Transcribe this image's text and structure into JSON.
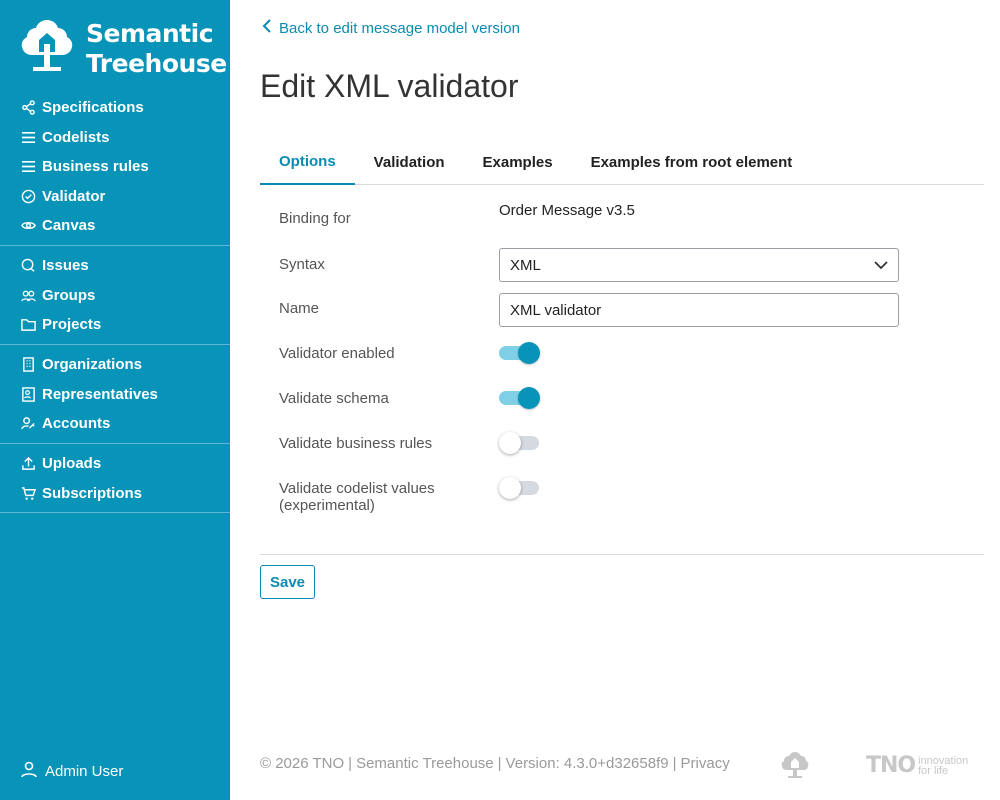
{
  "brand": {
    "name_line1": "Semantic",
    "name_line2": "Treehouse"
  },
  "sidebar": {
    "groups": [
      {
        "items": [
          {
            "label": "Specifications",
            "icon": "share-icon"
          },
          {
            "label": "Codelists",
            "icon": "list-icon"
          },
          {
            "label": "Business rules",
            "icon": "list-icon"
          },
          {
            "label": "Validator",
            "icon": "check-circle-icon"
          },
          {
            "label": "Canvas",
            "icon": "eye-icon"
          }
        ]
      },
      {
        "items": [
          {
            "label": "Issues",
            "icon": "chat-icon"
          },
          {
            "label": "Groups",
            "icon": "users-icon"
          },
          {
            "label": "Projects",
            "icon": "folder-icon"
          }
        ]
      },
      {
        "items": [
          {
            "label": "Organizations",
            "icon": "building-icon"
          },
          {
            "label": "Representatives",
            "icon": "id-card-icon"
          },
          {
            "label": "Accounts",
            "icon": "user-key-icon"
          }
        ]
      },
      {
        "items": [
          {
            "label": "Uploads",
            "icon": "upload-icon"
          },
          {
            "label": "Subscriptions",
            "icon": "cart-icon"
          }
        ]
      }
    ],
    "user": "Admin User"
  },
  "main": {
    "back_link": "Back to edit message model version",
    "title": "Edit XML validator",
    "tabs": [
      "Options",
      "Validation",
      "Examples",
      "Examples from root element"
    ],
    "active_tab": "Options",
    "form": {
      "binding_label": "Binding for",
      "binding_value": "Order Message v3.5",
      "syntax_label": "Syntax",
      "syntax_value": "XML",
      "name_label": "Name",
      "name_value": "XML validator",
      "validator_enabled_label": "Validator enabled",
      "validator_enabled": true,
      "validate_schema_label": "Validate schema",
      "validate_schema": true,
      "validate_business_rules_label": "Validate business rules",
      "validate_business_rules": false,
      "validate_codelist_label_line1": "Validate codelist values",
      "validate_codelist_label_line2": "(experimental)",
      "validate_codelist": false
    },
    "save_label": "Save"
  },
  "footer": {
    "copyright": "© 2026 TNO",
    "product": "Semantic Treehouse",
    "version": "Version: 4.3.0+d32658f9",
    "privacy": "Privacy",
    "sep": "|",
    "tno": "TNO",
    "tno_tagline_line1": "innovation",
    "tno_tagline_line2": "for life"
  },
  "colors": {
    "sidebar": "#0893b8",
    "accent": "#0b8bb0",
    "toggle_on_track": "#7fd0e6"
  }
}
